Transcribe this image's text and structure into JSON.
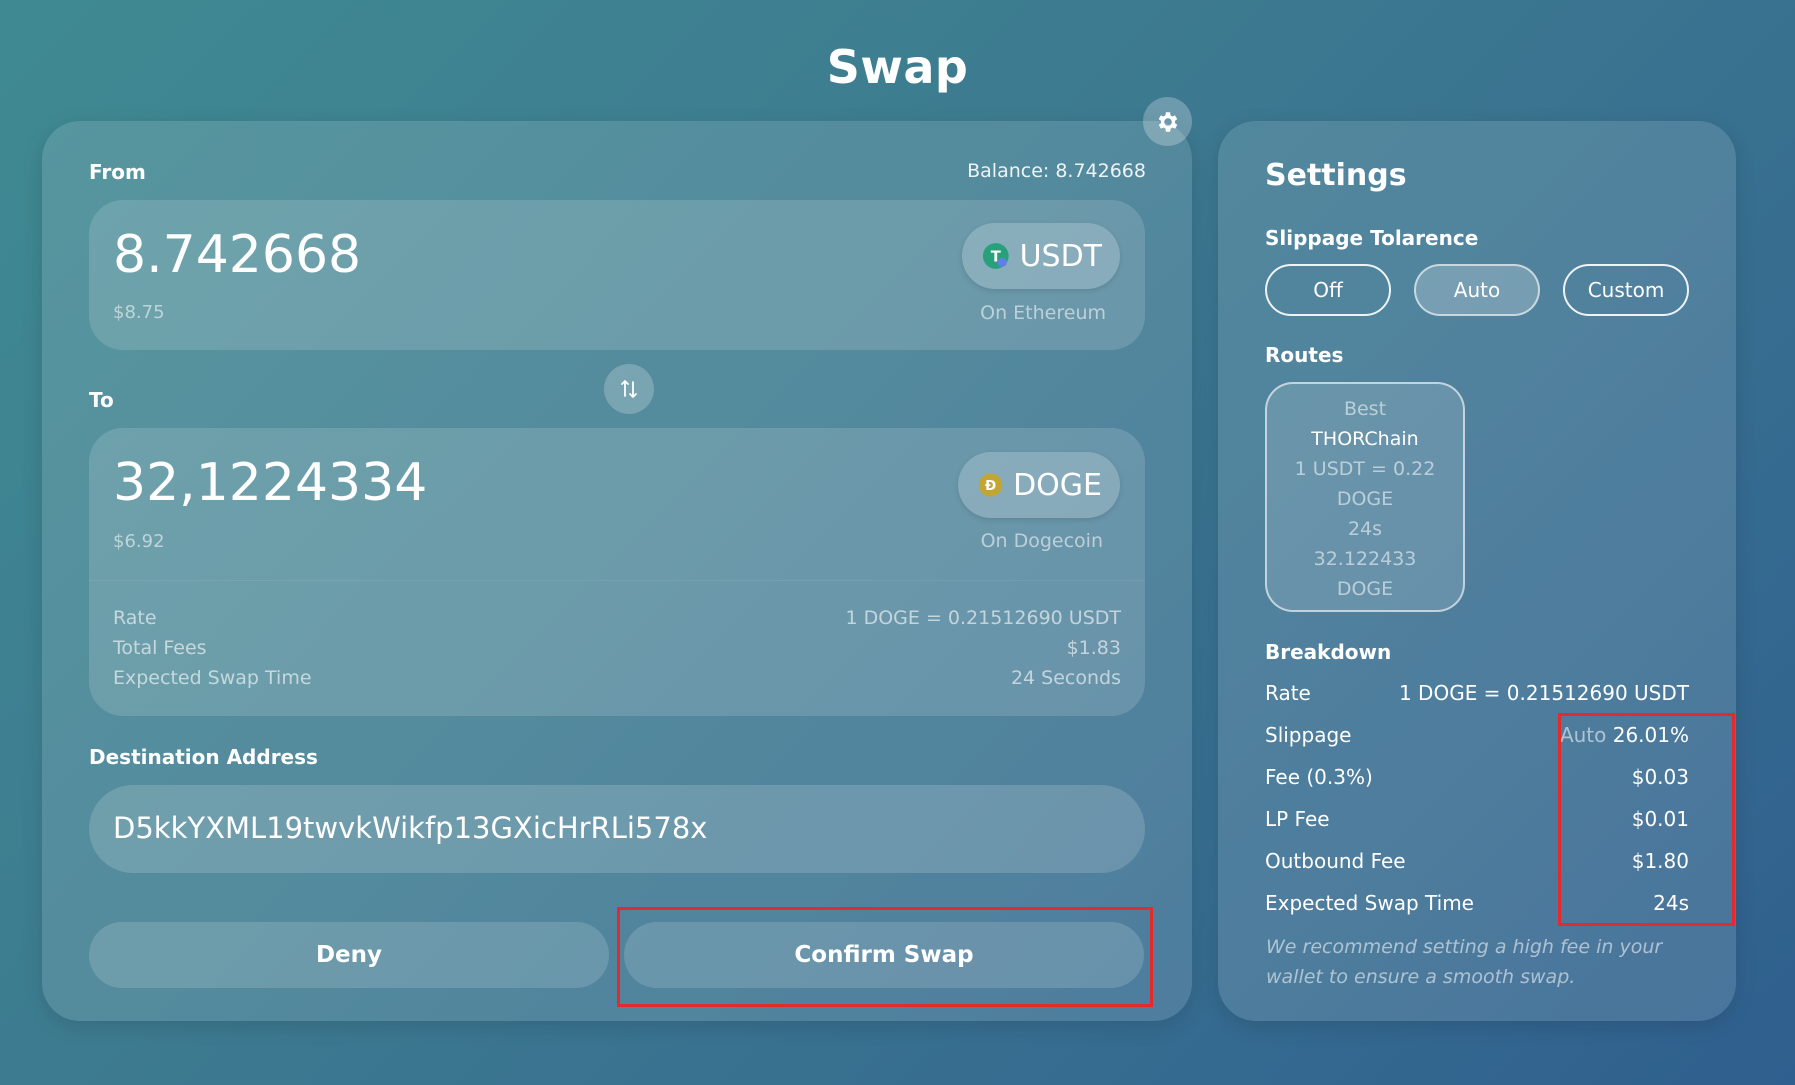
{
  "page": {
    "title": "Swap"
  },
  "swap": {
    "from": {
      "label": "From",
      "balance": "Balance: 8.742668",
      "amount": "8.742668",
      "usd": "$8.75",
      "token": "USDT",
      "token_icon_letter": "T",
      "network": "On Ethereum"
    },
    "to": {
      "label": "To",
      "amount": "32,1224334",
      "usd": "$6.92",
      "token": "DOGE",
      "token_icon_letter": "Ð",
      "network": "On Dogecoin"
    },
    "info": [
      {
        "label": "Rate",
        "value": "1 DOGE = 0.21512690 USDT"
      },
      {
        "label": "Total Fees",
        "value": "$1.83"
      },
      {
        "label": "Expected Swap Time",
        "value": "24 Seconds"
      }
    ],
    "destination": {
      "label": "Destination Address",
      "value": "D5kkYXML19twvkWikfp13GXicHrRLi578x"
    },
    "buttons": {
      "deny": "Deny",
      "confirm": "Confirm Swap"
    }
  },
  "settings": {
    "title": "Settings",
    "slippage": {
      "label": "Slippage Tolarence",
      "options": [
        "Off",
        "Auto",
        "Custom"
      ],
      "selected": "Auto"
    },
    "routes": {
      "label": "Routes",
      "items": [
        {
          "badge": "Best",
          "name": "THORChain",
          "rate_line1": "1 USDT = 0.22",
          "rate_line2": "DOGE",
          "time": "24s",
          "amount_line1": "32.122433",
          "amount_line2": "DOGE"
        }
      ]
    },
    "breakdown": {
      "label": "Breakdown",
      "rate_label": "Rate",
      "rate_value": "1 DOGE = 0.21512690 USDT",
      "slippage_label": "Slippage",
      "slippage_mode": "Auto",
      "slippage_value": "26.01%",
      "fee_label": "Fee (0.3%)",
      "fee_value": "$0.03",
      "lp_fee_label": "LP Fee",
      "lp_fee_value": "$0.01",
      "outbound_fee_label": "Outbound Fee",
      "outbound_fee_value": "$1.80",
      "swap_time_label": "Expected Swap Time",
      "swap_time_value": "24s"
    },
    "note": "We recommend setting a high fee in your wallet to ensure a smooth swap."
  },
  "colors": {
    "highlight": "#e32b2b",
    "usdt_icon": "#26a17b",
    "doge_icon": "#c2a633"
  }
}
